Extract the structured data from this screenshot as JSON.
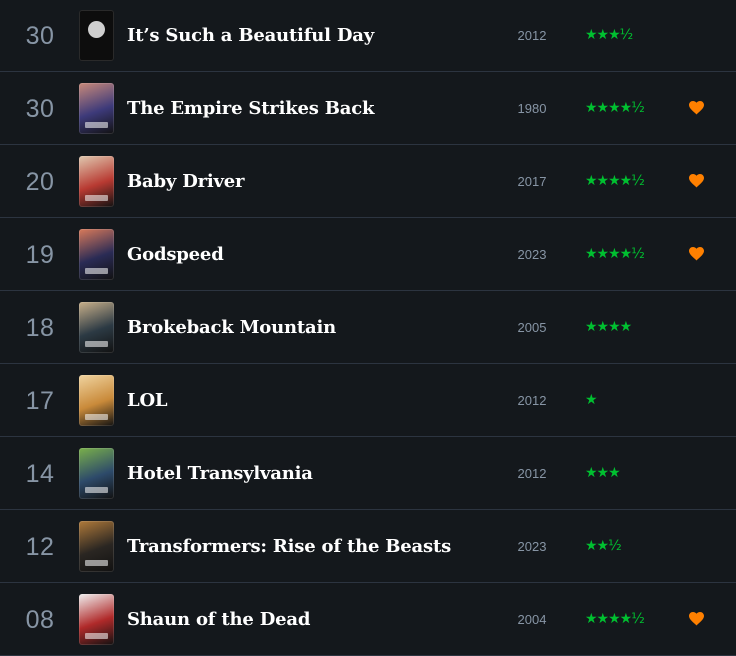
{
  "diary": {
    "rows": [
      {
        "day": "30",
        "title": "It’s Such a Beautiful Day",
        "year": "2012",
        "rating": "★★★½",
        "liked": false,
        "poster": {
          "bg": "#0d0d0d",
          "accent": "#cfcfcf",
          "style": "disc"
        }
      },
      {
        "day": "30",
        "title": "The Empire Strikes Back",
        "year": "1980",
        "rating": "★★★★½",
        "liked": true,
        "poster": {
          "bg": "#3d3a7a",
          "accent": "#c98a7a",
          "style": "grad"
        }
      },
      {
        "day": "20",
        "title": "Baby Driver",
        "year": "2017",
        "rating": "★★★★½",
        "liked": true,
        "poster": {
          "bg": "#b83a32",
          "accent": "#e0c9b0",
          "style": "grad"
        }
      },
      {
        "day": "19",
        "title": "Godspeed",
        "year": "2023",
        "rating": "★★★★½",
        "liked": true,
        "poster": {
          "bg": "#2a2b55",
          "accent": "#d97a5a",
          "style": "grad"
        }
      },
      {
        "day": "18",
        "title": "Brokeback Mountain",
        "year": "2005",
        "rating": "★★★★",
        "liked": false,
        "poster": {
          "bg": "#2c3a44",
          "accent": "#c8b08a",
          "style": "grad"
        }
      },
      {
        "day": "17",
        "title": "LOL",
        "year": "2012",
        "rating": "★",
        "liked": false,
        "poster": {
          "bg": "#c98a3a",
          "accent": "#f0d4a0",
          "style": "grad"
        }
      },
      {
        "day": "14",
        "title": "Hotel Transylvania",
        "year": "2012",
        "rating": "★★★",
        "liked": false,
        "poster": {
          "bg": "#2d4a6a",
          "accent": "#7ab04a",
          "style": "grad"
        }
      },
      {
        "day": "12",
        "title": "Transformers: Rise of the Beasts",
        "year": "2023",
        "rating": "★★½",
        "liked": false,
        "poster": {
          "bg": "#2a2622",
          "accent": "#b07a3a",
          "style": "grad"
        }
      },
      {
        "day": "08",
        "title": "Shaun of the Dead",
        "year": "2004",
        "rating": "★★★★½",
        "liked": true,
        "poster": {
          "bg": "#b02a2a",
          "accent": "#f0f0f0",
          "style": "grad"
        }
      }
    ]
  },
  "colors": {
    "background": "#14181c",
    "divider": "#2c3440",
    "muted_text": "#8795a5",
    "rating_green": "#00c030",
    "like_orange": "#ff8000"
  },
  "icons": {
    "like": "heart-icon",
    "rating": "star-rating"
  }
}
